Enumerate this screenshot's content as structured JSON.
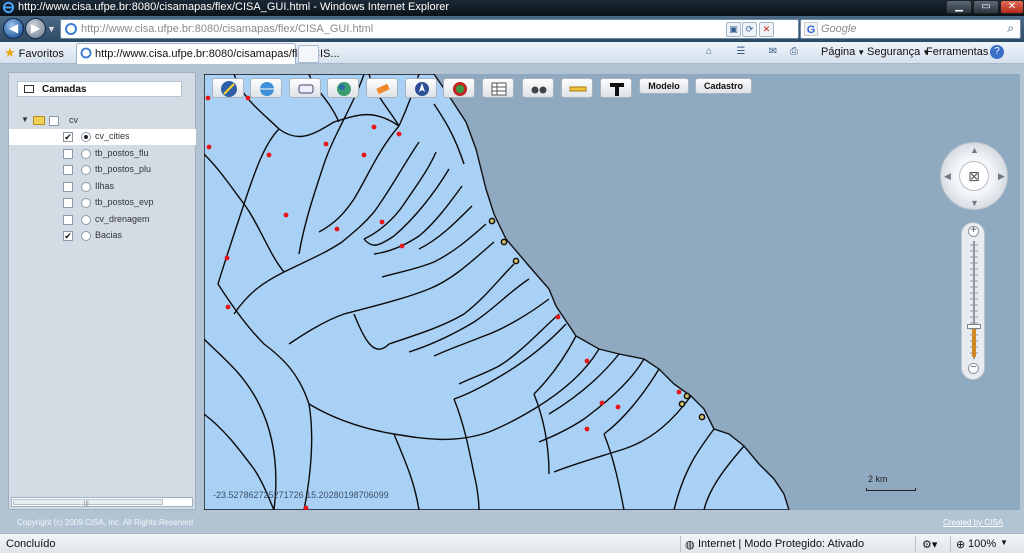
{
  "window": {
    "title": "http://www.cisa.ufpe.br:8080/cisamapas/flex/CISA_GUI.html - Windows Internet Explorer"
  },
  "address_bar": {
    "url": "http://www.cisa.ufpe.br:8080/cisamapas/flex/CISA_GUI.html",
    "search_placeholder": "Google"
  },
  "favorites_bar": {
    "favorites_label": "Favoritos",
    "tab_title": "http://www.cisa.ufpe.br:8080/cisamapas/flex/CIS...",
    "menus": [
      "Página",
      "Segurança",
      "Ferramentas"
    ]
  },
  "layers_panel": {
    "title": "Camadas",
    "group": {
      "name": "cv",
      "checked": false
    },
    "layers": [
      {
        "name": "cv_cities",
        "checked": true,
        "active": true
      },
      {
        "name": "tb_postos_flu",
        "checked": false,
        "active": false
      },
      {
        "name": "tb_postos_plu",
        "checked": false,
        "active": false
      },
      {
        "name": "Ilhas",
        "checked": false,
        "active": false
      },
      {
        "name": "tb_postos_evp",
        "checked": false,
        "active": false
      },
      {
        "name": "cv_drenagem",
        "checked": false,
        "active": false
      },
      {
        "name": "Bacias",
        "checked": true,
        "active": false
      }
    ]
  },
  "toolbar": {
    "tools": [
      "compass-icon",
      "globe-icon",
      "navigation-icon",
      "world-icon",
      "eraser-icon",
      "direction-icon",
      "stop-icon",
      "table-icon",
      "binoculars-icon",
      "ruler-icon",
      "hammer-icon"
    ],
    "model_button": "Modelo",
    "register_button": "Cadastro"
  },
  "map": {
    "coordinates": "-23.527862725271726 15.20280198706099",
    "scale_label": "2 km",
    "zoom_level": 0.22,
    "colors": {
      "land": "#a9d0f5",
      "sea": "#8fa9c0",
      "rivers": "#0b0b0b",
      "cities": "#e8161b"
    }
  },
  "footer": {
    "copyright": "Copyright (c) 2009 CISA, Inc. All Rights Reserved",
    "created_by": "Created by CISA"
  },
  "status_bar": {
    "status": "Concluído",
    "zone": "Internet | Modo Protegido: Ativado",
    "zoom": "100%"
  }
}
